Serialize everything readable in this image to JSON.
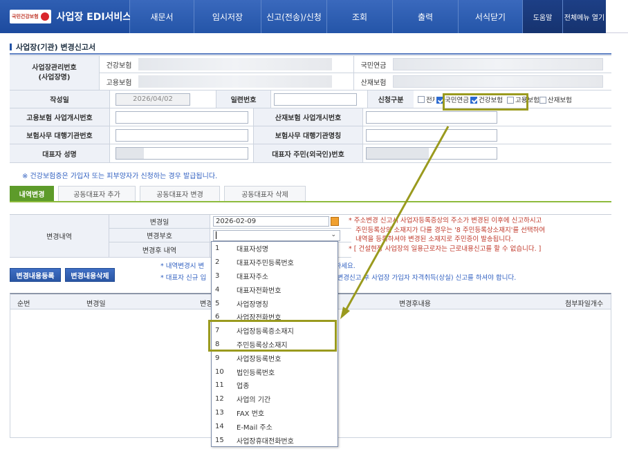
{
  "nav": {
    "logo_text": "국민건강보험",
    "title": "사업장 EDI서비스",
    "items": [
      "새문서",
      "임시저장",
      "신고(전송)/신청",
      "조회",
      "출력",
      "서식닫기"
    ],
    "help": "도움말",
    "all_menu": "전체메뉴 열기"
  },
  "page": {
    "title": "사업장(기관) 변경신고서"
  },
  "header": {
    "mgmt_label": "사업장관리번호\n(사업장명)",
    "health_ins": "건강보험",
    "employ_ins": "고용보험",
    "pension": "국민연금",
    "industrial": "산재보험",
    "date_label": "작성일",
    "date_value": "2026/04/02",
    "serial_label": "일련번호",
    "apply_label": "신청구분",
    "apply_options": [
      {
        "label": "전체",
        "checked": false
      },
      {
        "label": "국민연금",
        "checked": true
      },
      {
        "label": "건강보험",
        "checked": true
      },
      {
        "label": "고용보험",
        "checked": false
      },
      {
        "label": "산재보험",
        "checked": false
      }
    ],
    "employ_bizno_label": "고용보험 사업개시번호",
    "ind_bizno_label": "산재보험 사업개시번호",
    "agency_no_label": "보험사무 대행기관번호",
    "agency_name_label": "보험사무 대행기관명칭",
    "rep_name_label": "대표자 성명",
    "rep_id_label": "대표자 주민(외국인)번호"
  },
  "notice1": "※ 건강보험증은 가입자 또는 피부양자가 신청하는 경우 발급됩니다.",
  "tabs": [
    "내역변경",
    "공동대표자 추가",
    "공동대표자 변경",
    "공동대표자 삭제"
  ],
  "change": {
    "section_label": "변경내역",
    "date_label": "변경일",
    "date_value": "2026-02-09",
    "code_label": "변경부호",
    "after_label": "변경후 내역",
    "red_note_1": "* 주소변경 신고시 사업자등록증상의 주소가 변경된 이후에 신고하시고",
    "red_note_2": "주민등록상의 소재지가 다를 경우는 '8 주민등록상소재지'를 선택하여",
    "red_note_3": "내역을 등록하셔야 변경된 소재지로 주민증이 발송됩니다.",
    "red_note_4": "* [ 건설현장 사업장의 일용근로자는 근로내용신고를 할 수 없습니다. ]",
    "blue_note_1": "* 내역변경시 변",
    "blue_note_1b": "히 확인하세요.",
    "blue_note_2": "* 대표자 신규 입",
    "blue_note_2b": "장 내역변경신고 후 사업장 가입자 자격취득(상실) 신고를 하셔야 합니다."
  },
  "buttons": {
    "register": "변경내용등록",
    "delete": "변경내용삭제"
  },
  "list": {
    "headers": [
      "순번",
      "변경일",
      "변경",
      "변경후내용",
      "첨부파일개수"
    ],
    "empty_text": "."
  },
  "dropdown": {
    "options": [
      {
        "num": "1",
        "label": "대표자성명"
      },
      {
        "num": "2",
        "label": "대표자주민등록번호"
      },
      {
        "num": "3",
        "label": "대표자주소"
      },
      {
        "num": "4",
        "label": "대표자전화번호"
      },
      {
        "num": "5",
        "label": "사업장명칭"
      },
      {
        "num": "6",
        "label": "사업장전화번호"
      },
      {
        "num": "7",
        "label": "사업장등록증소재지"
      },
      {
        "num": "8",
        "label": "주민등록상소재지"
      },
      {
        "num": "9",
        "label": "사업장등록번호"
      },
      {
        "num": "10",
        "label": "법인등록번호"
      },
      {
        "num": "11",
        "label": "업종"
      },
      {
        "num": "12",
        "label": "사업의 기간"
      },
      {
        "num": "13",
        "label": "FAX 번호"
      },
      {
        "num": "14",
        "label": "E-Mail 주소"
      },
      {
        "num": "15",
        "label": "사업장휴대전화번호"
      }
    ]
  },
  "colors": {
    "nav": "#2455a8",
    "tab_active": "#5d9b2a",
    "callout": "#9a9a1e",
    "notice_blue": "#2f5fc0",
    "notice_red": "#c0392b"
  }
}
